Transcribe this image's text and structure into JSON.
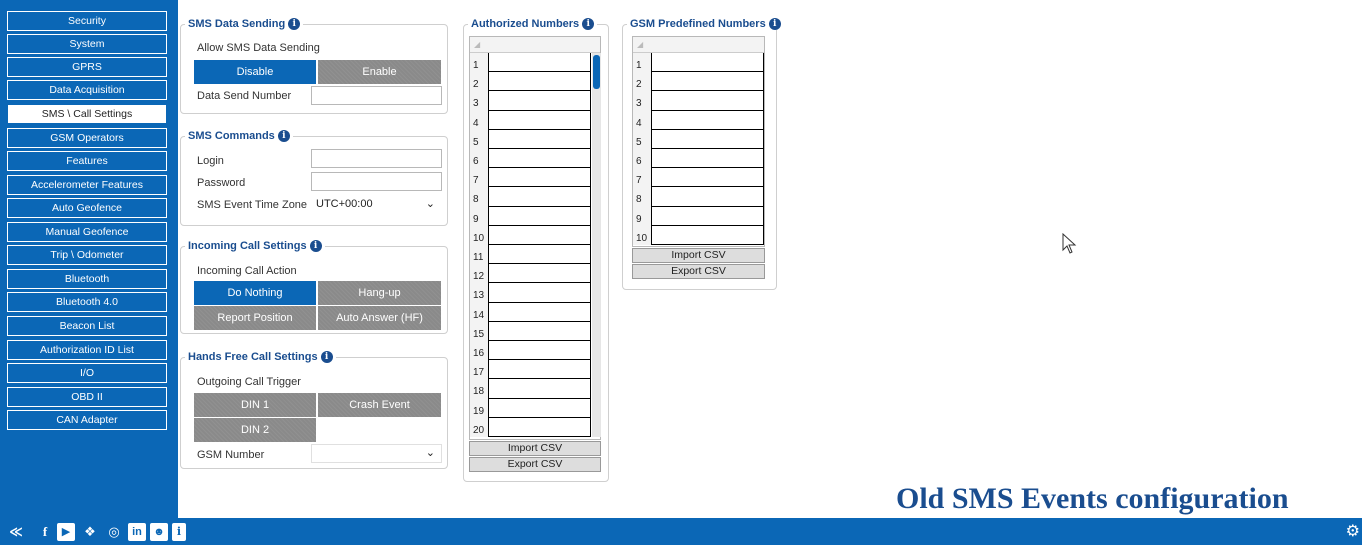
{
  "sidebar": {
    "items": [
      "Security",
      "System",
      "GPRS",
      "Data Acquisition",
      "SMS \\ Call Settings",
      "GSM Operators",
      "Features",
      "Accelerometer Features",
      "Auto Geofence",
      "Manual Geofence",
      "Trip \\ Odometer",
      "Bluetooth",
      "Bluetooth 4.0",
      "Beacon List",
      "Authorization ID List",
      "I/O",
      "OBD II",
      "CAN Adapter"
    ],
    "active_index": 4
  },
  "sms_data_sending": {
    "title": "SMS Data Sending",
    "allow_label": "Allow SMS Data Sending",
    "disable": "Disable",
    "enable": "Enable",
    "selected": "Disable",
    "number_label": "Data Send Number",
    "number_value": ""
  },
  "sms_commands": {
    "title": "SMS Commands",
    "login_label": "Login",
    "login_value": "",
    "password_label": "Password",
    "password_value": "",
    "tz_label": "SMS Event Time Zone",
    "tz_value": "UTC+00:00"
  },
  "incoming_call": {
    "title": "Incoming Call Settings",
    "action_label": "Incoming Call Action",
    "do_nothing": "Do Nothing",
    "hang_up": "Hang-up",
    "report_position": "Report Position",
    "auto_answer": "Auto Answer (HF)",
    "selected": "Do Nothing"
  },
  "hands_free": {
    "title": "Hands Free Call Settings",
    "trigger_label": "Outgoing Call Trigger",
    "din1": "DIN 1",
    "crash_event": "Crash Event",
    "din2": "DIN 2",
    "gsm_label": "GSM Number",
    "gsm_value": ""
  },
  "authorized_numbers": {
    "title": "Authorized Numbers",
    "rows": [
      "1",
      "2",
      "3",
      "4",
      "5",
      "6",
      "7",
      "8",
      "9",
      "10",
      "11",
      "12",
      "13",
      "14",
      "15",
      "16",
      "17",
      "18",
      "19",
      "20"
    ],
    "import_csv": "Import CSV",
    "export_csv": "Export CSV"
  },
  "gsm_predefined": {
    "title": "GSM Predefined Numbers",
    "rows": [
      "1",
      "2",
      "3",
      "4",
      "5",
      "6",
      "7",
      "8",
      "9",
      "10"
    ],
    "import_csv": "Import CSV",
    "export_csv": "Export CSV"
  },
  "caption": "Old SMS Events configuration",
  "footer": {
    "icons": [
      "collapse-icon",
      "facebook-icon",
      "youtube-icon",
      "twitter-icon",
      "instagram-icon",
      "linkedin-icon",
      "chat-icon",
      "info-icon",
      "gear-icon"
    ]
  },
  "colors": {
    "brand_blue": "#0b67b6",
    "title_blue": "#1a4d8f",
    "button_gray": "#8a8a8a"
  }
}
